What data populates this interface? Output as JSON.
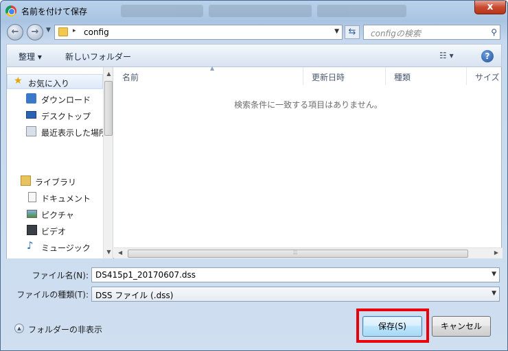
{
  "window": {
    "title": "名前を付けて保存",
    "close_label": "x"
  },
  "address_bar": {
    "path": "config",
    "separator": "▸",
    "search_placeholder": "configの検索"
  },
  "toolbar": {
    "organize_label": "整理 ▾",
    "new_folder_label": "新しいフォルダー",
    "help_label": "?"
  },
  "nav_pane": {
    "favorites": {
      "label": "お気に入り",
      "items": [
        "ダウンロード",
        "デスクトップ",
        "最近表示した場所"
      ]
    },
    "libraries": {
      "label": "ライブラリ",
      "items": [
        "ドキュメント",
        "ピクチャ",
        "ビデオ",
        "ミュージック"
      ]
    }
  },
  "file_list": {
    "columns": [
      "名前",
      "更新日時",
      "種類",
      "サイズ"
    ],
    "empty_message": "検索条件に一致する項目はありません。"
  },
  "form": {
    "filename_label": "ファイル名(N):",
    "filename_value": "DS415p1_20170607.dss",
    "filetype_label": "ファイルの種類(T):",
    "filetype_value": "DSS ファイル (.dss)"
  },
  "footer": {
    "hide_folders_label": "フォルダーの非表示",
    "save_button": "保存(S)",
    "cancel_button": "キャンセル"
  },
  "colors": {
    "highlight": "#e8000b",
    "accent": "#3c7fb1"
  }
}
